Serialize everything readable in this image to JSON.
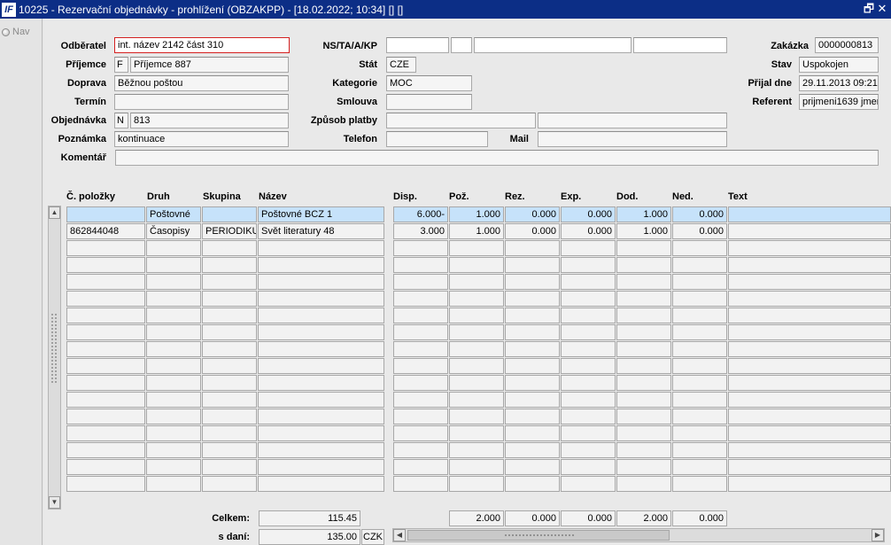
{
  "window": {
    "title": "10225 - Rezervační objednávky -  prohlížení (OBZAKPP) - [18.02.2022; 10:34]  [] []",
    "app_icon": "IF",
    "restore_glyph": "🗗",
    "close_glyph": "✕"
  },
  "nav": {
    "label": "Nav"
  },
  "form": {
    "odberatel": {
      "label": "Odběratel",
      "value": "int. název 2142 část 310"
    },
    "prijemce": {
      "label": "Příjemce",
      "type": "F",
      "value": "Příjemce 887"
    },
    "doprava": {
      "label": "Doprava",
      "value": "Běžnou poštou"
    },
    "termin": {
      "label": "Termín",
      "value": ""
    },
    "objednavka": {
      "label": "Objednávka",
      "type": "N",
      "value": "813"
    },
    "poznamka": {
      "label": "Poznámka",
      "value": "kontinuace"
    },
    "komentar": {
      "label": "Komentář",
      "value": ""
    },
    "ns": {
      "label": "NS/TA/A/KP",
      "v1": "",
      "v2": "",
      "v3": "",
      "v4": ""
    },
    "stat": {
      "label": "Stát",
      "value": "CZE"
    },
    "kategorie": {
      "label": "Kategorie",
      "value": "MOC"
    },
    "smlouva": {
      "label": "Smlouva",
      "value": ""
    },
    "zpusob_platby": {
      "label": "Způsob platby",
      "v1": "",
      "v2": ""
    },
    "telefon": {
      "label": "Telefon",
      "value": ""
    },
    "mail": {
      "label": "Mail",
      "value": ""
    },
    "zakazka": {
      "label": "Zakázka",
      "value": "0000000813"
    },
    "stav": {
      "label": "Stav",
      "value": "Uspokojen"
    },
    "prijal_dne": {
      "label": "Přijal dne",
      "value": "29.11.2013 09:21"
    },
    "referent": {
      "label": "Referent",
      "value": "prijmeni1639 jmen"
    }
  },
  "grid": {
    "headers": {
      "cislo": "Č. položky",
      "druh": "Druh",
      "skupina": "Skupina",
      "nazev": "Název",
      "disp": "Disp.",
      "poz": "Pož.",
      "rez": "Rez.",
      "exp": "Exp.",
      "dod": "Dod.",
      "ned": "Ned.",
      "text": "Text"
    },
    "rows": [
      {
        "cislo": "",
        "druh": "Poštovné",
        "skupina": "",
        "nazev": "Poštovné BCZ 1",
        "disp": "6.000-",
        "poz": "1.000",
        "rez": "0.000",
        "exp": "0.000",
        "dod": "1.000",
        "ned": "0.000",
        "text": ""
      },
      {
        "cislo": "862844048",
        "druh": "Časopisy",
        "skupina": "PERIODIKUM",
        "nazev": "Svět literatury 48",
        "disp": "3.000",
        "poz": "1.000",
        "rez": "0.000",
        "exp": "0.000",
        "dod": "1.000",
        "ned": "0.000",
        "text": ""
      }
    ],
    "empty_rows": 15
  },
  "totals": {
    "celkem_label": "Celkem:",
    "celkem_value": "115.45",
    "sdani_label": "s daní:",
    "sdani_value": "135.00",
    "currency": "CZK",
    "poz": "2.000",
    "rez": "0.000",
    "exp": "0.000",
    "dod": "2.000",
    "ned": "0.000"
  },
  "colors": {
    "titlebar": "#0c2e86",
    "selected_row": "#c6e2fa",
    "focus_border": "#d42020"
  }
}
